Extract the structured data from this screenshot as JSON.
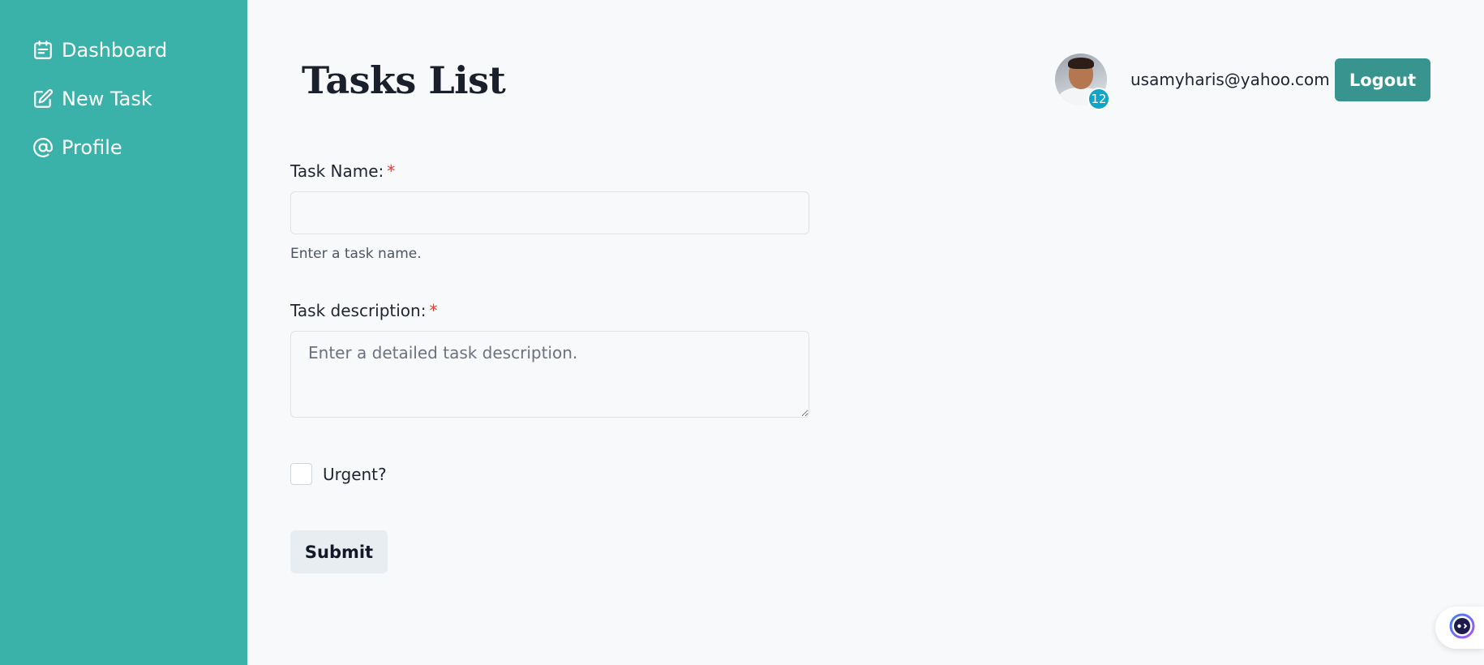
{
  "sidebar": {
    "items": [
      {
        "label": "Dashboard",
        "icon": "calendar-icon"
      },
      {
        "label": "New Task",
        "icon": "edit-icon"
      },
      {
        "label": "Profile",
        "icon": "at-sign-icon"
      }
    ]
  },
  "header": {
    "title": "Tasks List",
    "user": {
      "email": "usamyharis@yahoo.com",
      "notification_count": "12"
    },
    "logout_label": "Logout"
  },
  "form": {
    "task_name": {
      "label": "Task Name:",
      "required_mark": "*",
      "value": "",
      "helper": "Enter a task name."
    },
    "task_description": {
      "label": "Task description:",
      "required_mark": "*",
      "placeholder": "Enter a detailed task description."
    },
    "urgent": {
      "label": "Urgent?",
      "checked": false
    },
    "submit_label": "Submit"
  },
  "colors": {
    "sidebar_bg": "#3ab1a9",
    "logout_bg": "#37948f",
    "badge_bg": "#0ea5c6",
    "required": "#d9443a",
    "page_bg": "#f7f9fb"
  }
}
